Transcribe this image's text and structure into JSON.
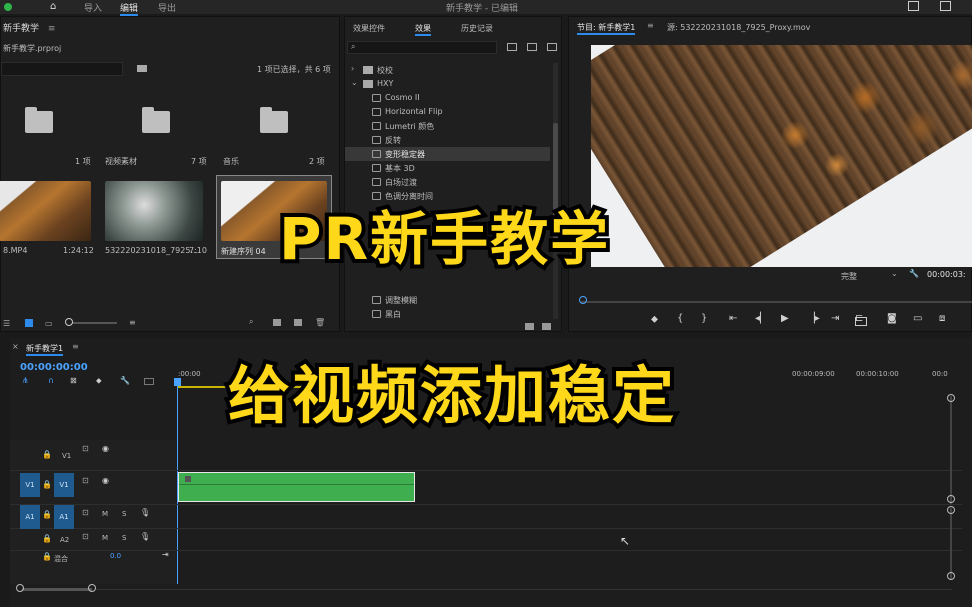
{
  "topbar": {
    "workspaces": [
      "导入",
      "编辑",
      "导出"
    ],
    "title": "新手教学 - 已编辑"
  },
  "project": {
    "tab": "新手教学",
    "file": "新手教学.prproj",
    "selection": "1 项已选择，共 6 项",
    "folders": [
      {
        "name": "",
        "count": "1 项"
      },
      {
        "name": "视频素材",
        "count": "7 项"
      },
      {
        "name": "音乐",
        "count": "2 项"
      }
    ],
    "clips": [
      {
        "name": "8.MP4",
        "duration": "1:24:12"
      },
      {
        "name": "532220231018_7925...",
        "duration": "7:10"
      },
      {
        "name": "新建序列 04",
        "duration": ""
      }
    ]
  },
  "effects": {
    "tabs": [
      "效果控件",
      "效果",
      "历史记录"
    ],
    "items": [
      {
        "label": "校校",
        "type": "folder"
      },
      {
        "label": "HXY",
        "type": "folder-open"
      },
      {
        "label": "Cosmo II",
        "type": "fx"
      },
      {
        "label": "Horizontal Flip",
        "type": "fx"
      },
      {
        "label": "Lumetri 颜色",
        "type": "fx"
      },
      {
        "label": "反转",
        "type": "fx"
      },
      {
        "label": "变形稳定器",
        "type": "fx",
        "selected": true
      },
      {
        "label": "基本 3D",
        "type": "fx"
      },
      {
        "label": "白场过渡",
        "type": "fx"
      },
      {
        "label": "色调分离时间",
        "type": "fx"
      }
    ],
    "bottom_items": [
      "调整模糊",
      "黑白"
    ]
  },
  "program": {
    "tab": "节目: 新手教学1",
    "source": "源: 532220231018_7925_Proxy.mov",
    "quality": "完整",
    "timecode": "00:00:03:"
  },
  "timeline": {
    "tab": "新手教学1",
    "timecode": "00:00:00:00",
    "ruler": [
      ":00:00",
      "00:00:09:00",
      "00:00:10:00",
      "00:0"
    ],
    "tracks": {
      "v1": "V1",
      "v1_src": "V1",
      "a1": "A1",
      "a1_src": "A1",
      "a2": "A2",
      "master": "混合",
      "master_value": "0.0"
    }
  },
  "overlay": {
    "title": "PR新手教学",
    "subtitle": "给视频添加稳定"
  },
  "colors": {
    "accent": "#2d8ceb",
    "clip": "#3fae4f",
    "overlay_text": "#ffd81a"
  }
}
